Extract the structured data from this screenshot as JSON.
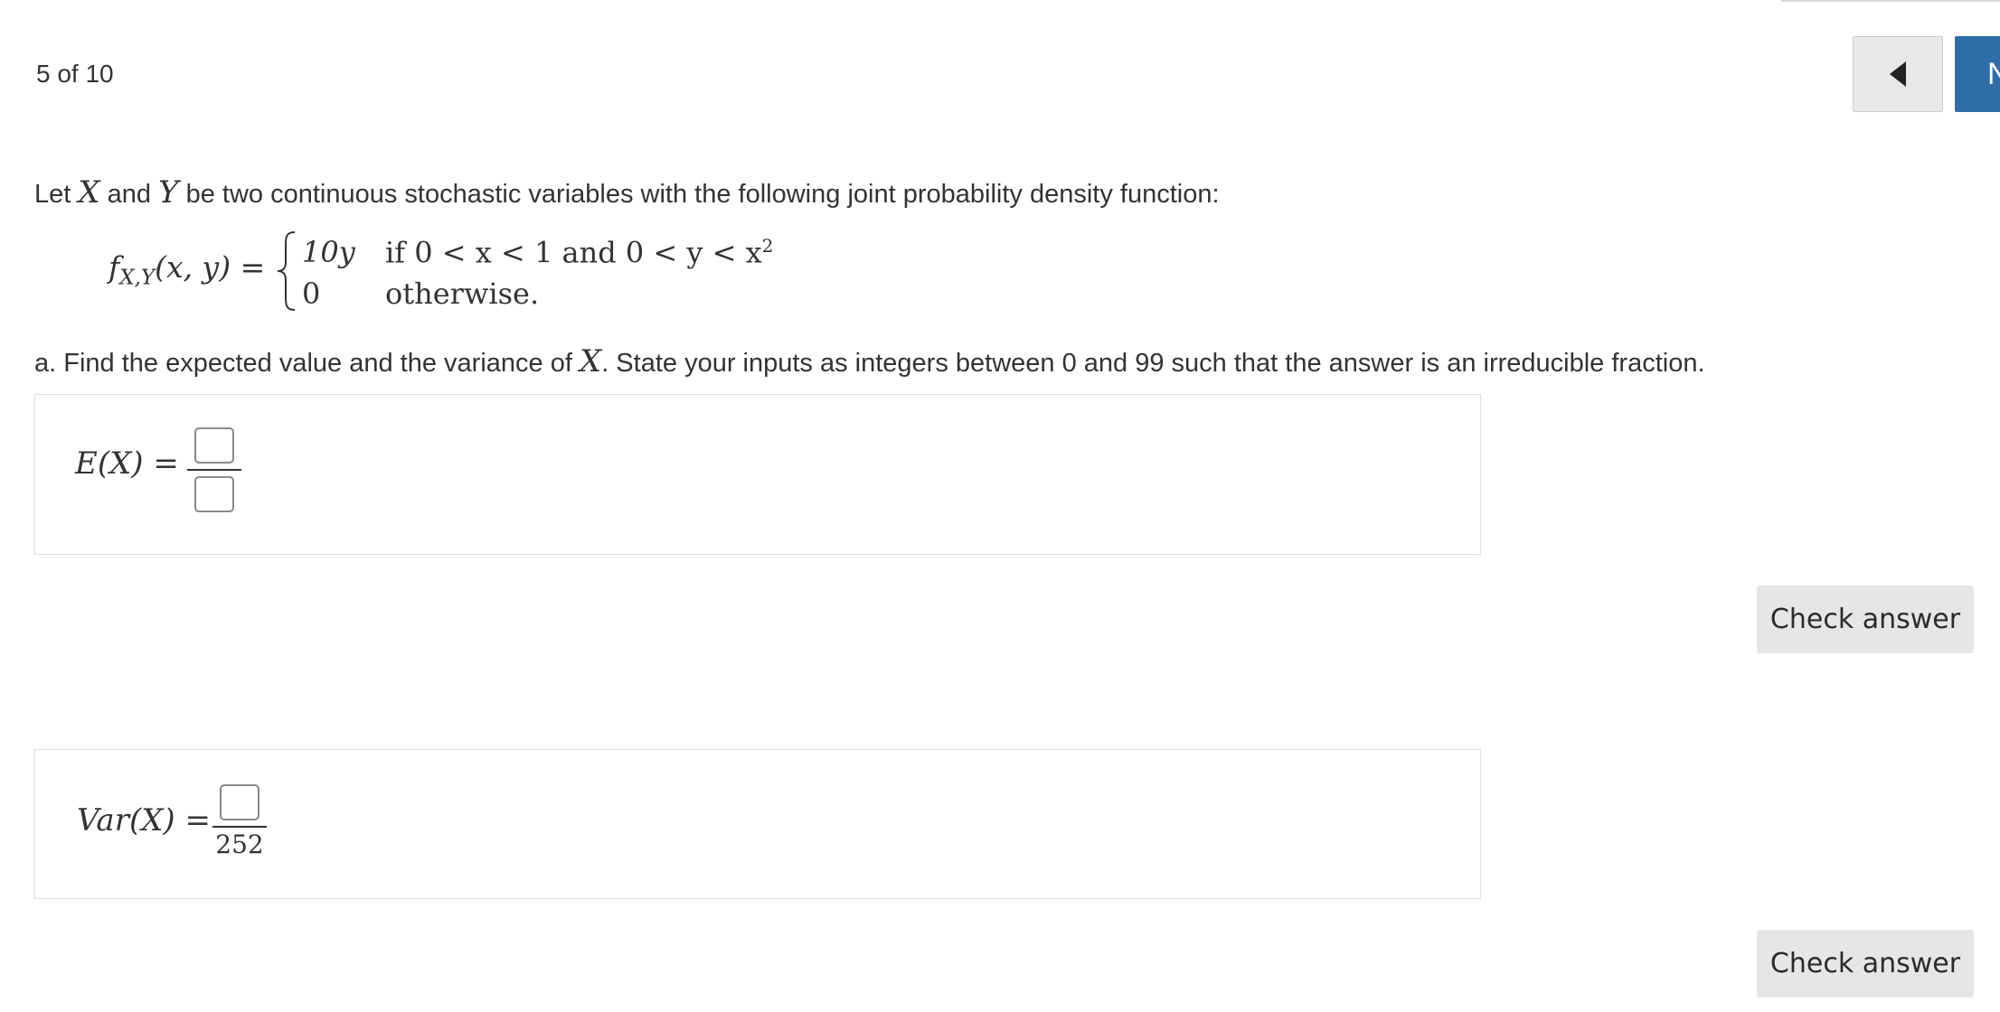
{
  "nav": {
    "progress": "5 of 10",
    "prev_icon": "triangle-left-icon",
    "next_label": "N"
  },
  "problem": {
    "intro_pre": "Let ",
    "var_x": "X",
    "intro_and": " and ",
    "var_y": "Y",
    "intro_post": " be two continuous stochastic variables with the following joint probability density function:",
    "pdf_name": "f",
    "pdf_sub": "X,Y",
    "pdf_args": "(x, y) =",
    "case1_value": "10y",
    "case1_condition_pre": "if 0 < x < 1 and 0 < y < x",
    "case1_condition_sup": "2",
    "case2_value": "0",
    "case2_condition": "otherwise.",
    "question_pre": "a. Find the expected value and the variance of ",
    "question_var": "X",
    "question_post": ". State your inputs as integers between 0 and 99 such that the answer is an irreducible fraction."
  },
  "answers": {
    "ex_label": "E(X) =",
    "ex_numerator": "",
    "ex_denominator": "",
    "var_label": "Var(X) =",
    "var_numerator": "",
    "var_denominator": "252",
    "check_label": "Check answer"
  }
}
